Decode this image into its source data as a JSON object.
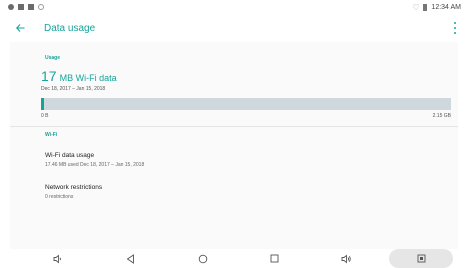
{
  "status_bar": {
    "time": "12:34 AM"
  },
  "toolbar": {
    "title": "Data usage",
    "back_icon": "arrow-back-icon",
    "overflow_icon": "more-vert-icon"
  },
  "usage": {
    "section_label": "Usage",
    "amount": "17",
    "unit": "MB Wi-Fi data",
    "period": "Dec 18, 2017 – Jan 15, 2018",
    "bar_min": "0 B",
    "bar_max": "2.15 GB",
    "fraction_used": 0.008
  },
  "wifi": {
    "section_label": "Wi-Fi",
    "items": [
      {
        "title": "Wi-Fi data usage",
        "summary": "17.46 MB used Dec 18, 2017 – Jan 15, 2018"
      },
      {
        "title": "Network restrictions",
        "summary": "0 restrictions"
      }
    ]
  },
  "nav_bar": {
    "buttons": [
      "volume-down-icon",
      "back-triangle-icon",
      "home-circle-icon",
      "recents-square-icon",
      "volume-up-icon",
      "screenshot-icon"
    ]
  },
  "colors": {
    "accent": "#15a49a",
    "bar_track": "#cfd8dc"
  }
}
